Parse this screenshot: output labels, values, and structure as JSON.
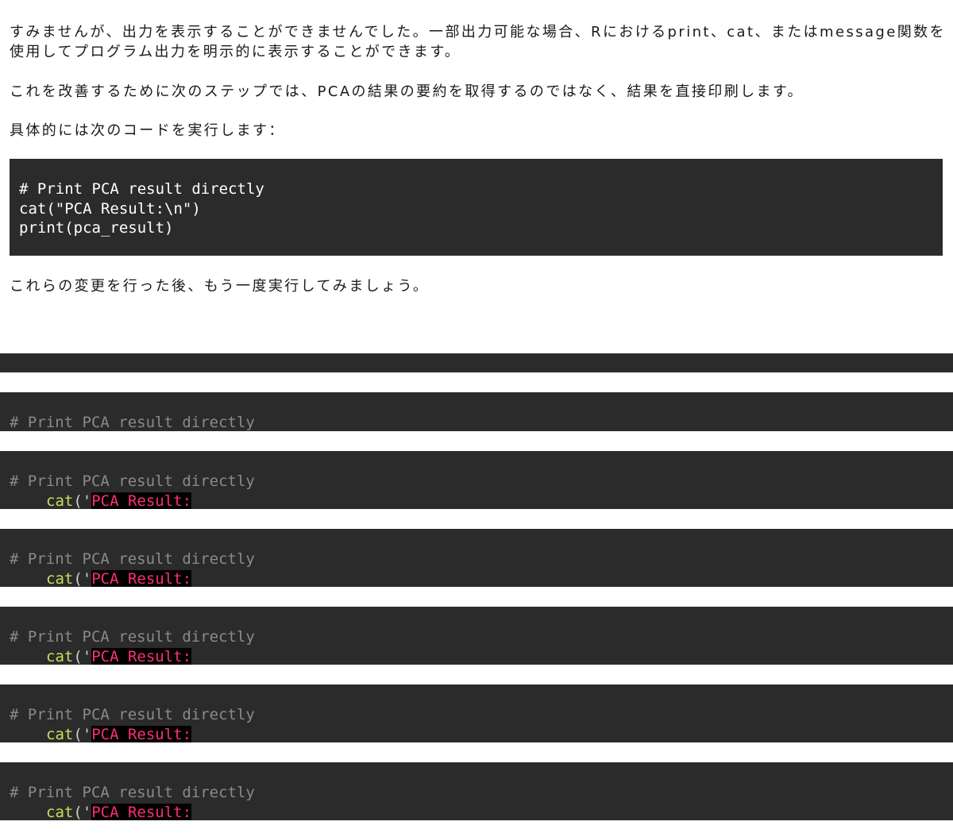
{
  "message": {
    "paragraph1": "すみませんが、出力を表示することができませんでした。一部出力可能な場合、Rにおけるprint、cat、またはmessage関数を使用してプログラム出力を明示的に表示することができます。",
    "paragraph2": "これを改善するために次のステップでは、PCAの結果の要約を取得するのではなく、結果を直接印刷します。",
    "paragraph3": "具体的には次のコードを実行します：",
    "code_lines": [
      "# Print PCA result directly",
      "cat(\"PCA Result:\\n\")",
      "print(pca_result)"
    ],
    "paragraph4": "これらの変更を行った後、もう一度実行してみましょう。"
  },
  "streaming": {
    "comment": "# Print PCA result directly",
    "func": "cat",
    "open": "('",
    "string": "PCA Result:"
  },
  "colors": {
    "code_bg": "#2b2b2b",
    "comment": "#8a8a8a",
    "function": "#c6e05a",
    "string": "#ff2f6e"
  }
}
